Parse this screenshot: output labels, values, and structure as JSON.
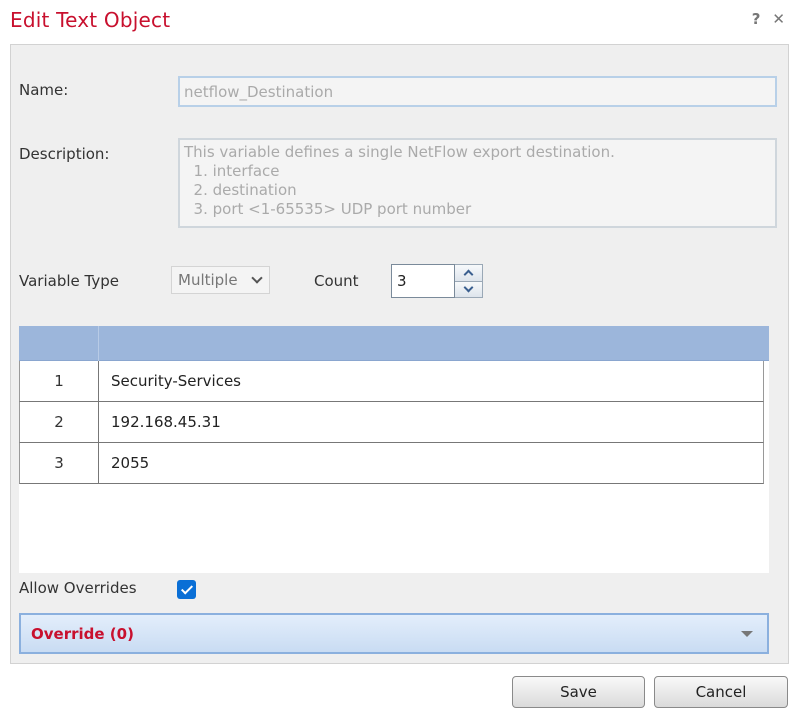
{
  "dialog": {
    "title": "Edit Text Object",
    "help_icon": "?",
    "close_icon": "✕"
  },
  "form": {
    "name_label": "Name:",
    "name_value": "netflow_Destination",
    "description_label": "Description:",
    "description_value": "This variable defines a single NetFlow export destination.\n  1. interface\n  2. destination\n  3. port <1-65535> UDP port number",
    "variable_type_label": "Variable Type",
    "variable_type_value": "Multiple",
    "count_label": "Count",
    "count_value": "3"
  },
  "table": {
    "columns": [
      "",
      ""
    ],
    "rows": [
      {
        "index": "1",
        "value": "Security-Services"
      },
      {
        "index": "2",
        "value": "192.168.45.31"
      },
      {
        "index": "3",
        "value": "2055"
      }
    ]
  },
  "overrides": {
    "allow_label": "Allow Overrides",
    "allow_checked": true,
    "override_label": "Override (0)"
  },
  "buttons": {
    "save": "Save",
    "cancel": "Cancel"
  },
  "colors": {
    "title": "#c8102e",
    "grid_header": "#9cb6db",
    "checkbox": "#0a6fd6"
  }
}
